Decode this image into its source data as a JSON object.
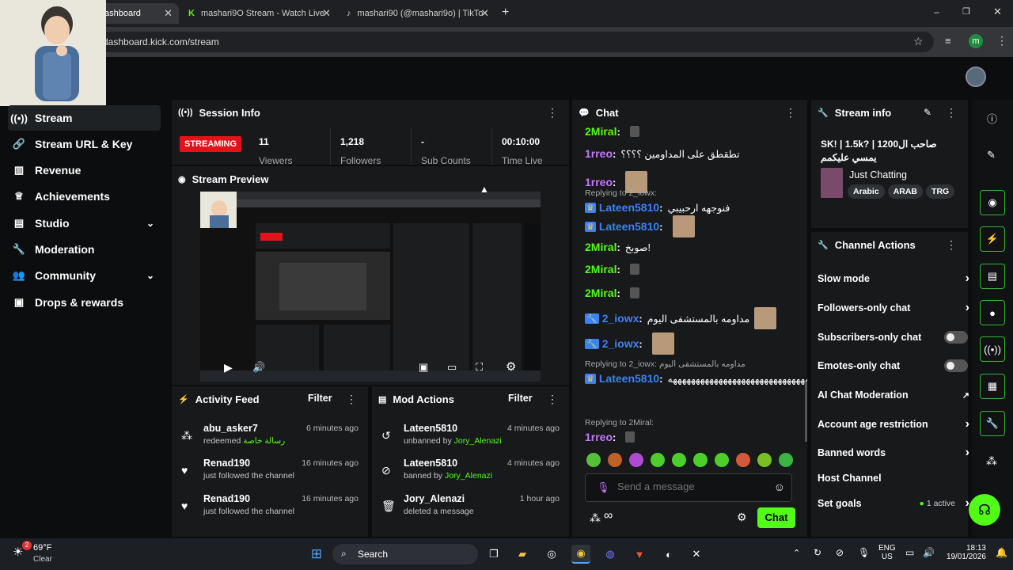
{
  "browser": {
    "tabs": [
      {
        "label": "ashboard",
        "active": true
      },
      {
        "label": "mashari9O Stream - Watch Live",
        "active": false
      },
      {
        "label": "mashari90 (@mashari9o) | TikTo",
        "active": false
      }
    ],
    "url": "dashboard.kick.com/stream",
    "profile_initial": "m"
  },
  "sidebar": {
    "items": [
      {
        "label": "Stream",
        "icon": "broadcast-icon",
        "active": true
      },
      {
        "label": "Stream URL & Key",
        "icon": "link-icon"
      },
      {
        "label": "Revenue",
        "icon": "chart-icon"
      },
      {
        "label": "Achievements",
        "icon": "trophy-icon"
      },
      {
        "label": "Studio",
        "icon": "studio-icon",
        "expandable": true
      },
      {
        "label": "Moderation",
        "icon": "wrench-icon"
      },
      {
        "label": "Community",
        "icon": "community-icon",
        "expandable": true
      },
      {
        "label": "Drops & rewards",
        "icon": "gift-icon"
      }
    ]
  },
  "session": {
    "title": "Session Info",
    "status": "STREAMING",
    "stats": [
      {
        "value": "11",
        "label": "Viewers"
      },
      {
        "value": "1,218",
        "label": "Followers"
      },
      {
        "value": "-",
        "label": "Sub Counts"
      },
      {
        "value": "00:10:00",
        "label": "Time Live"
      }
    ]
  },
  "preview": {
    "title": "Stream Preview"
  },
  "activity": {
    "title": "Activity Feed",
    "filter": "Filter",
    "items": [
      {
        "name": "abu_asker7",
        "sub": "redeemed",
        "reward": "رسالة خاصة",
        "time": "6 minutes ago",
        "icon": "dots-icon"
      },
      {
        "name": "Renad190",
        "sub": "just followed the channel",
        "time": "16 minutes ago",
        "icon": "heart-icon"
      },
      {
        "name": "Renad190",
        "sub": "just followed the channel",
        "time": "16 minutes ago",
        "icon": "heart-icon"
      }
    ]
  },
  "mod": {
    "title": "Mod Actions",
    "filter": "Filter",
    "items": [
      {
        "name": "Lateen5810",
        "sub": "unbanned by",
        "by": "Jory_Alenazi",
        "time": "4 minutes ago",
        "icon": "undo-icon"
      },
      {
        "name": "Lateen5810",
        "sub": "banned by",
        "by": "Jory_Alenazi",
        "time": "4 minutes ago",
        "icon": "ban-icon"
      },
      {
        "name": "Jory_Alenazi",
        "sub": "deleted a message",
        "by": "",
        "time": "1 hour ago",
        "icon": "trash-icon"
      }
    ]
  },
  "chat": {
    "title": "Chat",
    "messages": [
      {
        "user": "2Miral",
        "color": "#53fc18",
        "text": "",
        "badge": ""
      },
      {
        "user": "1rreo",
        "color": "#c576ff",
        "text": "تطقطق على المداومين ؟؟؟؟",
        "badge": ""
      },
      {
        "user": "1rreo",
        "color": "#c576ff",
        "text": "",
        "badge": ""
      },
      {
        "user": "Lateen5810",
        "color": "#3b82f6",
        "text": "فنوجهه ارحبيبي",
        "badge": "crown",
        "reply": "Replying to 2_iowx:"
      },
      {
        "user": "Lateen5810",
        "color": "#3b82f6",
        "text": "",
        "badge": "crown"
      },
      {
        "user": "2Miral",
        "color": "#53fc18",
        "text": "صوبخ!",
        "badge": ""
      },
      {
        "user": "2Miral",
        "color": "#53fc18",
        "text": "",
        "badge": ""
      },
      {
        "user": "2Miral",
        "color": "#53fc18",
        "text": "",
        "badge": ""
      },
      {
        "user": "2_iowx",
        "color": "#3b82f6",
        "text": "مداومه بالمستشفى اليوم",
        "badge": "wrench"
      },
      {
        "user": "2_iowx",
        "color": "#3b82f6",
        "text": "",
        "badge": "wrench"
      },
      {
        "user": "Lateen5810",
        "color": "#3b82f6",
        "text": "ههههههههههههههههههههههههههههههههههههه",
        "badge": "crown",
        "reply": "Replying to 2_iowx: مداومه بالمستشفى اليوم"
      },
      {
        "user": "1rreo",
        "color": "#c576ff",
        "text": "",
        "badge": "",
        "reply": "Replying to 2Miral:"
      }
    ],
    "placeholder": "Send a message",
    "send": "Chat"
  },
  "streaminfo": {
    "title": "Stream info",
    "stream_title": "SK! | 1.5k? | صاحب ال1200 يمسي عليكمم",
    "category": "Just Chatting",
    "tags": [
      "Arabic",
      "ARAB",
      "TRG"
    ]
  },
  "actions": {
    "title": "Channel Actions",
    "items": [
      {
        "label": "Slow mode",
        "control": "chevron"
      },
      {
        "label": "Followers-only chat",
        "control": "chevron"
      },
      {
        "label": "Subscribers-only chat",
        "control": "toggle"
      },
      {
        "label": "Emotes-only chat",
        "control": "toggle"
      },
      {
        "label": "AI Chat Moderation",
        "control": "external"
      },
      {
        "label": "Account age restriction",
        "control": "chevron"
      },
      {
        "label": "Banned words",
        "control": "chevron"
      },
      {
        "label": "Host Channel",
        "control": "none"
      },
      {
        "label": "Set goals",
        "control": "chevron",
        "status": "1 active"
      }
    ]
  },
  "taskbar": {
    "weather_temp": "69°F",
    "weather_desc": "Clear",
    "weather_badge": "2",
    "search": "Search",
    "lang1": "ENG",
    "lang2": "US",
    "time": "18:13",
    "date": "19/01/2026"
  },
  "colors": {
    "accent": "#53fc18",
    "streaming": "#e4131a",
    "panel": "#17191b"
  }
}
